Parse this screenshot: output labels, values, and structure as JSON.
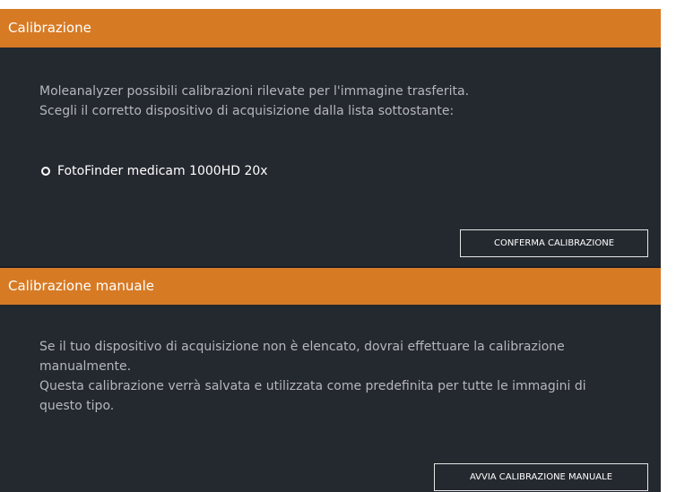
{
  "calibration": {
    "title": "Calibrazione",
    "description_line1": "Moleanalyzer possibili calibrazioni rilevate per l'immagine trasferita.",
    "description_line2": "Scegli il corretto dispositivo di acquisizione dalla lista sottostante:",
    "options": [
      {
        "label": "FotoFinder medicam 1000HD 20x",
        "selected": false
      }
    ],
    "confirm_label": "CONFERMA CALIBRAZIONE"
  },
  "manual_calibration": {
    "title": "Calibrazione manuale",
    "description_line1": "Se il tuo dispositivo di acquisizione non è elencato, dovrai effettuare la calibrazione",
    "description_line2": "manualmente.",
    "description_line3": "Questa calibrazione verrà salvata e utilizzata come predefinita per tutte le immagini di",
    "description_line4": "questo tipo.",
    "start_label": "AVVIA CALIBRAZIONE MANUALE"
  },
  "colors": {
    "header_orange": "#d77a24",
    "panel_bg": "#24282f",
    "text_secondary": "#b5b7bb",
    "text_primary": "#ffffff"
  }
}
